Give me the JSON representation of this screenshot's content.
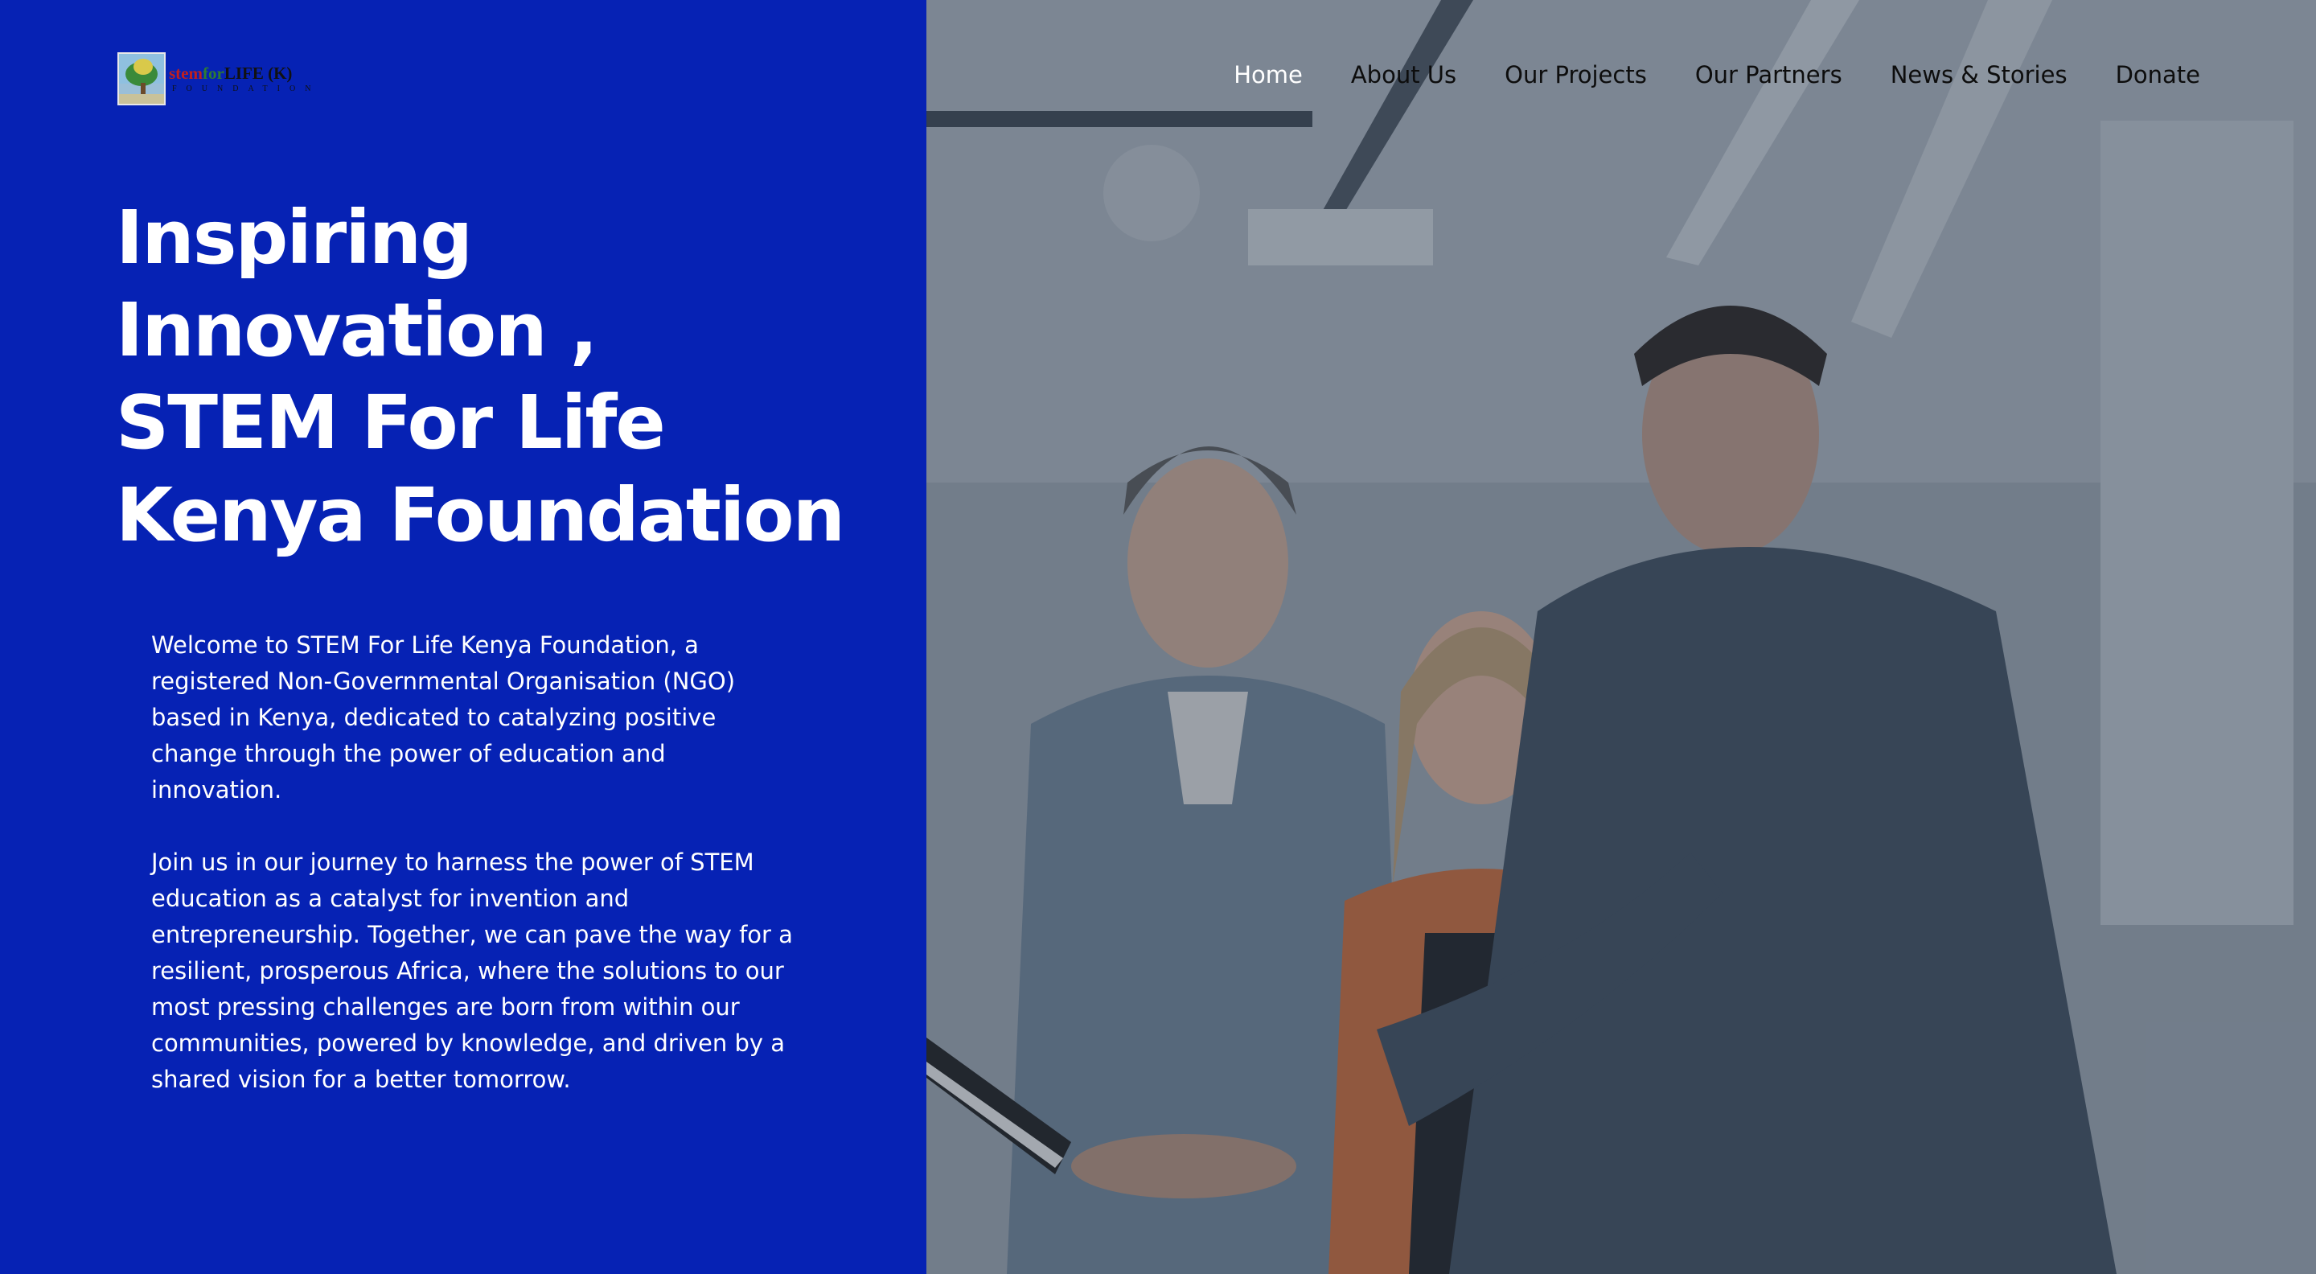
{
  "logo": {
    "word1": "stem",
    "word2": "for",
    "word3": "LIFE (K)",
    "subline": "FOUNDATION"
  },
  "nav": {
    "items": [
      {
        "label": "Home",
        "active": true
      },
      {
        "label": "About Us",
        "active": false
      },
      {
        "label": "Our Projects",
        "active": false
      },
      {
        "label": "Our Partners",
        "active": false
      },
      {
        "label": "News & Stories",
        "active": false
      },
      {
        "label": "Donate",
        "active": false
      }
    ]
  },
  "hero": {
    "title_lines": [
      "Inspiring",
      "Innovation ,",
      "STEM For Life",
      "Kenya Foundation"
    ],
    "paragraphs": [
      "Welcome to STEM For Life Kenya Foundation, a registered Non-Governmental Organisation (NGO) based in Kenya, dedicated to catalyzing positive change through the power of education and innovation.",
      "Join us in our journey to harness the power of STEM education as a catalyst for invention and entrepreneurship. Together, we can pave the way for a resilient, prosperous Africa, where the solutions to our most pressing challenges are born from within our communities, powered by knowledge, and driven by a shared vision for a better tomorrow."
    ]
  },
  "colors": {
    "brand_blue": "#0622b4",
    "nav_active": "#ffffff",
    "nav_text": "#0d0d0d"
  }
}
